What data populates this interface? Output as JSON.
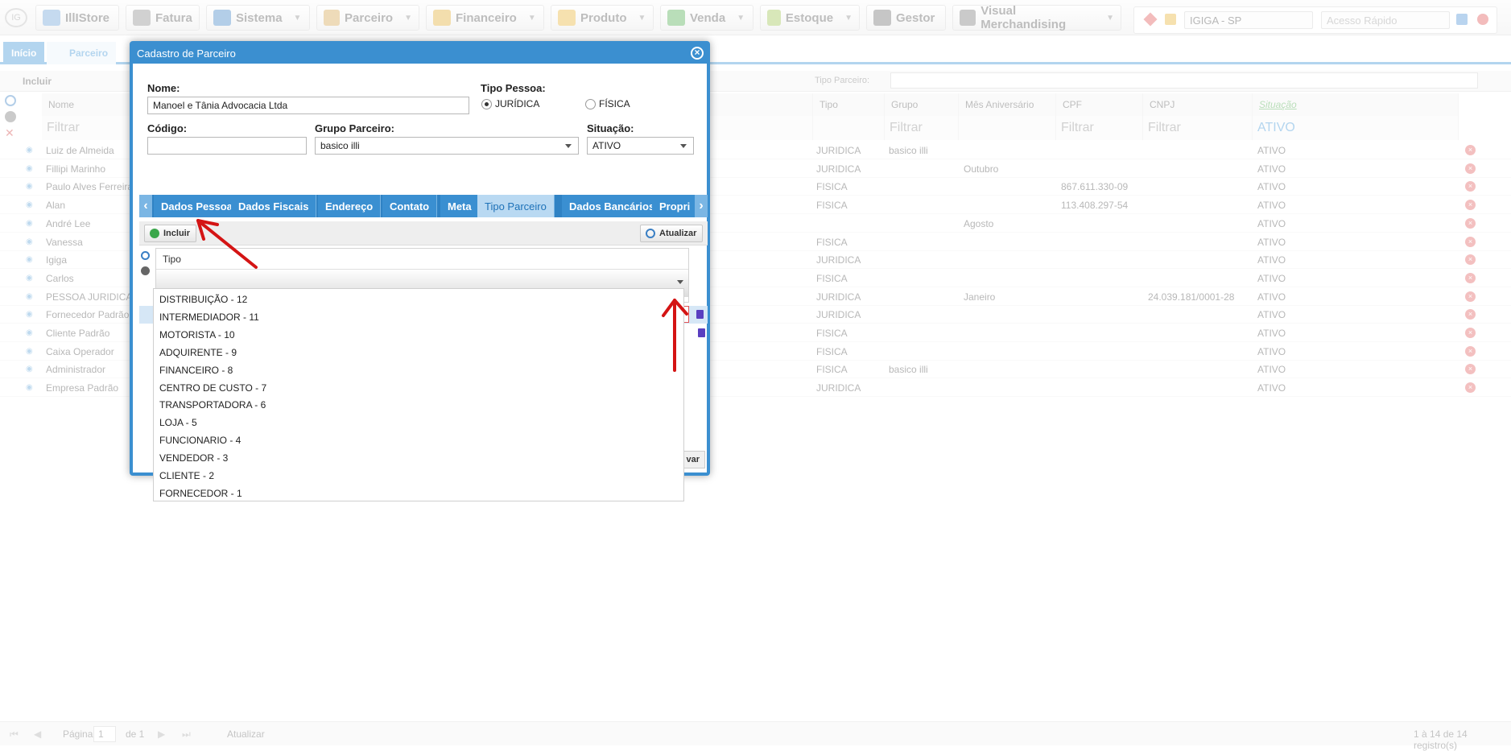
{
  "topbar": {
    "logo_text": "IG",
    "menu": [
      {
        "label": "IllIStore",
        "icon": "store-icon",
        "color": "#6a9fd6"
      },
      {
        "label": "Fatura",
        "icon": "barcode-icon",
        "color": "#888888"
      },
      {
        "label": "Sistema",
        "icon": "gear-icon",
        "color": "#3a7fc4"
      },
      {
        "label": "Parceiro",
        "icon": "people-icon",
        "color": "#d4a24a"
      },
      {
        "label": "Financeiro",
        "icon": "bar-chart-icon",
        "color": "#e0a92a"
      },
      {
        "label": "Produto",
        "icon": "box-icon",
        "color": "#e8b22f"
      },
      {
        "label": "Venda",
        "icon": "cart-icon",
        "color": "#4aa94a"
      },
      {
        "label": "Estoque",
        "icon": "hand-box-icon",
        "color": "#9bc24a"
      },
      {
        "label": "Gestor",
        "icon": "presentation-icon",
        "color": "#6b6b6b"
      },
      {
        "label": "Visual Merchandising",
        "icon": "shelf-icon",
        "color": "#777777"
      }
    ],
    "store_select": "IGIGA - SP",
    "quick_access_placeholder": "Acesso Rápido"
  },
  "tabs": {
    "home": "Início",
    "parceiro": "Parceiro"
  },
  "toolbar": {
    "incluir": "Incluir",
    "tipo_parceiro_label": "Tipo Parceiro:"
  },
  "grid": {
    "columns": [
      "Nome",
      "Tipo",
      "Grupo",
      "Mês Aniversário",
      "CPF",
      "CNPJ",
      "Situação"
    ],
    "filter_placeholder": "Filtrar",
    "situacao_filter": "ATIVO",
    "rows": [
      {
        "nome": "Luiz de Almeida",
        "tipo": "JURIDICA",
        "grupo": "basico illi",
        "mes": "",
        "cpf": "",
        "cnpj": "",
        "situacao": "ATIVO"
      },
      {
        "nome": "Fillipi Marinho",
        "tipo": "JURIDICA",
        "grupo": "",
        "mes": "Outubro",
        "cpf": "",
        "cnpj": "",
        "situacao": "ATIVO"
      },
      {
        "nome": "Paulo Alves Ferreira",
        "tipo": "FISICA",
        "grupo": "",
        "mes": "",
        "cpf": "867.611.330-09",
        "cnpj": "",
        "situacao": "ATIVO"
      },
      {
        "nome": "Alan",
        "tipo": "FISICA",
        "grupo": "",
        "mes": "",
        "cpf": "113.408.297-54",
        "cnpj": "",
        "situacao": "ATIVO"
      },
      {
        "nome": "André Lee",
        "tipo": "",
        "grupo": "",
        "mes": "Agosto",
        "cpf": "",
        "cnpj": "",
        "situacao": "ATIVO"
      },
      {
        "nome": "Vanessa",
        "tipo": "FISICA",
        "grupo": "",
        "mes": "",
        "cpf": "",
        "cnpj": "",
        "situacao": "ATIVO"
      },
      {
        "nome": "Igiga",
        "tipo": "JURIDICA",
        "grupo": "",
        "mes": "",
        "cpf": "",
        "cnpj": "",
        "situacao": "ATIVO"
      },
      {
        "nome": "Carlos",
        "tipo": "FISICA",
        "grupo": "",
        "mes": "",
        "cpf": "",
        "cnpj": "",
        "situacao": "ATIVO"
      },
      {
        "nome": "PESSOA JURIDICA",
        "tipo": "JURIDICA",
        "grupo": "",
        "mes": "Janeiro",
        "cpf": "",
        "cnpj": "24.039.181/0001-28",
        "situacao": "ATIVO"
      },
      {
        "nome": "Fornecedor Padrão",
        "tipo": "JURIDICA",
        "grupo": "",
        "mes": "",
        "cpf": "",
        "cnpj": "",
        "situacao": "ATIVO"
      },
      {
        "nome": "Cliente Padrão",
        "tipo": "FISICA",
        "grupo": "",
        "mes": "",
        "cpf": "",
        "cnpj": "",
        "situacao": "ATIVO"
      },
      {
        "nome": "Caixa Operador",
        "tipo": "FISICA",
        "grupo": "",
        "mes": "",
        "cpf": "",
        "cnpj": "",
        "situacao": "ATIVO"
      },
      {
        "nome": "Administrador",
        "tipo": "FISICA",
        "grupo": "basico illi",
        "mes": "",
        "cpf": "",
        "cnpj": "",
        "situacao": "ATIVO"
      },
      {
        "nome": "Empresa Padrão",
        "tipo": "JURIDICA",
        "grupo": "",
        "mes": "",
        "cpf": "",
        "cnpj": "",
        "situacao": "ATIVO"
      }
    ]
  },
  "footer": {
    "pagina_label": "Página",
    "page": "1",
    "of": "de 1",
    "refresh": "Atualizar",
    "records": "1 à 14 de 14 registro(s)"
  },
  "dialog": {
    "title": "Cadastro de Parceiro",
    "nome_label": "Nome:",
    "nome_value": "Manoel e Tânia Advocacia Ltda",
    "tipo_pessoa_label": "Tipo Pessoa:",
    "tipo_juridica": "JURÍDICA",
    "tipo_fisica": "FÍSICA",
    "codigo_label": "Código:",
    "codigo_value": "",
    "grupo_label": "Grupo Parceiro:",
    "grupo_value": "basico illi",
    "situacao_label": "Situação:",
    "situacao_value": "ATIVO",
    "tabs": [
      "Dados Pessoais",
      "Dados Fiscais",
      "Endereço",
      "Contato",
      "Meta",
      "Tipo Parceiro",
      "Dados Bancários",
      "Propri"
    ],
    "active_tab": "Tipo Parceiro",
    "incluir": "Incluir",
    "atualizar": "Atualizar",
    "sub_column": "Tipo",
    "salvar_partial": "var",
    "options": [
      "DISTRIBUIÇÃO - 12",
      "INTERMEDIADOR - 11",
      "MOTORISTA - 10",
      "ADQUIRENTE - 9",
      "FINANCEIRO - 8",
      "CENTRO DE CUSTO - 7",
      "TRANSPORTADORA - 6",
      "LOJA - 5",
      "FUNCIONARIO - 4",
      "VENDEDOR - 3",
      "CLIENTE - 2",
      "FORNECEDOR - 1"
    ]
  },
  "colors": {
    "dialog_blue": "#3b8fd0",
    "annotation_red": "#d41414"
  }
}
